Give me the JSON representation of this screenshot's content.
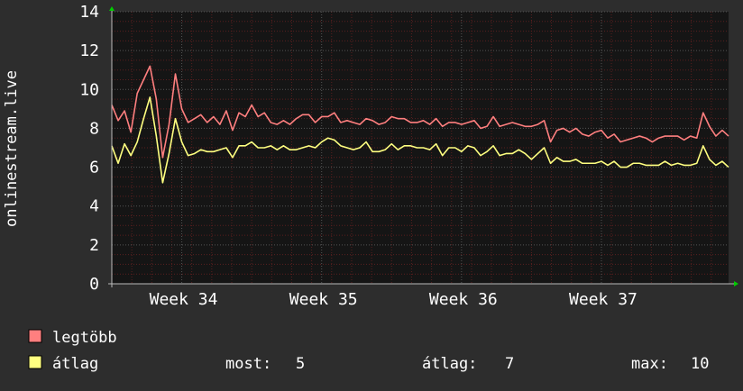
{
  "chart_data": {
    "type": "line",
    "ylabel": "onlinestream.live",
    "ylim": [
      0,
      14
    ],
    "yticks": [
      0,
      2,
      4,
      6,
      8,
      10,
      12,
      14
    ],
    "week_labels": [
      "Week 34",
      "Week 35",
      "Week 36",
      "Week 37"
    ],
    "grid": true,
    "colors": {
      "background": "#2d2d2d",
      "plot_area": "#151515",
      "grid_minor": "#5a1f1f",
      "grid_major": "#555555",
      "axis": "#bbbbbb",
      "axis_arrow": "#00cc00",
      "text": "#ffffff"
    },
    "x_range": [
      0,
      97
    ],
    "week_tick_positions": [
      11,
      33,
      55,
      77
    ],
    "series": [
      {
        "name": "legtöbb",
        "color": "#ff7f7f",
        "values": [
          9.2,
          8.4,
          8.9,
          7.8,
          9.8,
          10.5,
          11.2,
          9.5,
          6.5,
          8.2,
          10.8,
          9.0,
          8.3,
          8.5,
          8.7,
          8.3,
          8.6,
          8.2,
          8.9,
          7.9,
          8.8,
          8.6,
          9.2,
          8.6,
          8.8,
          8.3,
          8.2,
          8.4,
          8.2,
          8.5,
          8.7,
          8.7,
          8.3,
          8.6,
          8.6,
          8.8,
          8.3,
          8.4,
          8.3,
          8.2,
          8.5,
          8.4,
          8.2,
          8.3,
          8.6,
          8.5,
          8.5,
          8.3,
          8.3,
          8.4,
          8.2,
          8.5,
          8.1,
          8.3,
          8.3,
          8.2,
          8.3,
          8.4,
          8.0,
          8.1,
          8.6,
          8.1,
          8.2,
          8.3,
          8.2,
          8.1,
          8.1,
          8.2,
          8.4,
          7.3,
          7.9,
          8.0,
          7.8,
          8.0,
          7.7,
          7.6,
          7.8,
          7.9,
          7.5,
          7.7,
          7.3,
          7.4,
          7.5,
          7.6,
          7.5,
          7.3,
          7.5,
          7.6,
          7.6,
          7.6,
          7.4,
          7.6,
          7.5,
          8.8,
          8.1,
          7.6,
          7.9,
          7.6
        ]
      },
      {
        "name": "átlag",
        "color": "#ffff80",
        "values": [
          7.1,
          6.2,
          7.2,
          6.6,
          7.3,
          8.5,
          9.6,
          7.6,
          5.2,
          6.7,
          8.5,
          7.3,
          6.6,
          6.7,
          6.9,
          6.8,
          6.8,
          6.9,
          7.0,
          6.5,
          7.1,
          7.1,
          7.3,
          7.0,
          7.0,
          7.1,
          6.9,
          7.1,
          6.9,
          6.9,
          7.0,
          7.1,
          7.0,
          7.3,
          7.5,
          7.4,
          7.1,
          7.0,
          6.9,
          7.0,
          7.3,
          6.8,
          6.8,
          6.9,
          7.2,
          6.9,
          7.1,
          7.1,
          7.0,
          7.0,
          6.9,
          7.2,
          6.6,
          7.0,
          7.0,
          6.8,
          7.1,
          7.0,
          6.6,
          6.8,
          7.1,
          6.6,
          6.7,
          6.7,
          6.9,
          6.7,
          6.4,
          6.7,
          7.0,
          6.2,
          6.5,
          6.3,
          6.3,
          6.4,
          6.2,
          6.2,
          6.2,
          6.3,
          6.1,
          6.3,
          6.0,
          6.0,
          6.2,
          6.2,
          6.1,
          6.1,
          6.1,
          6.3,
          6.1,
          6.2,
          6.1,
          6.1,
          6.2,
          7.1,
          6.4,
          6.1,
          6.3,
          6.0
        ]
      }
    ]
  },
  "legend": {
    "items": [
      {
        "name": "legtöbb",
        "color": "#ff7f7f"
      },
      {
        "name": "átlag",
        "color": "#ffff80"
      }
    ],
    "stats": {
      "now_label": "most:",
      "now_value": "5",
      "avg_label": "átlag:",
      "avg_value": "7",
      "max_label": "max:",
      "max_value": "10"
    }
  }
}
